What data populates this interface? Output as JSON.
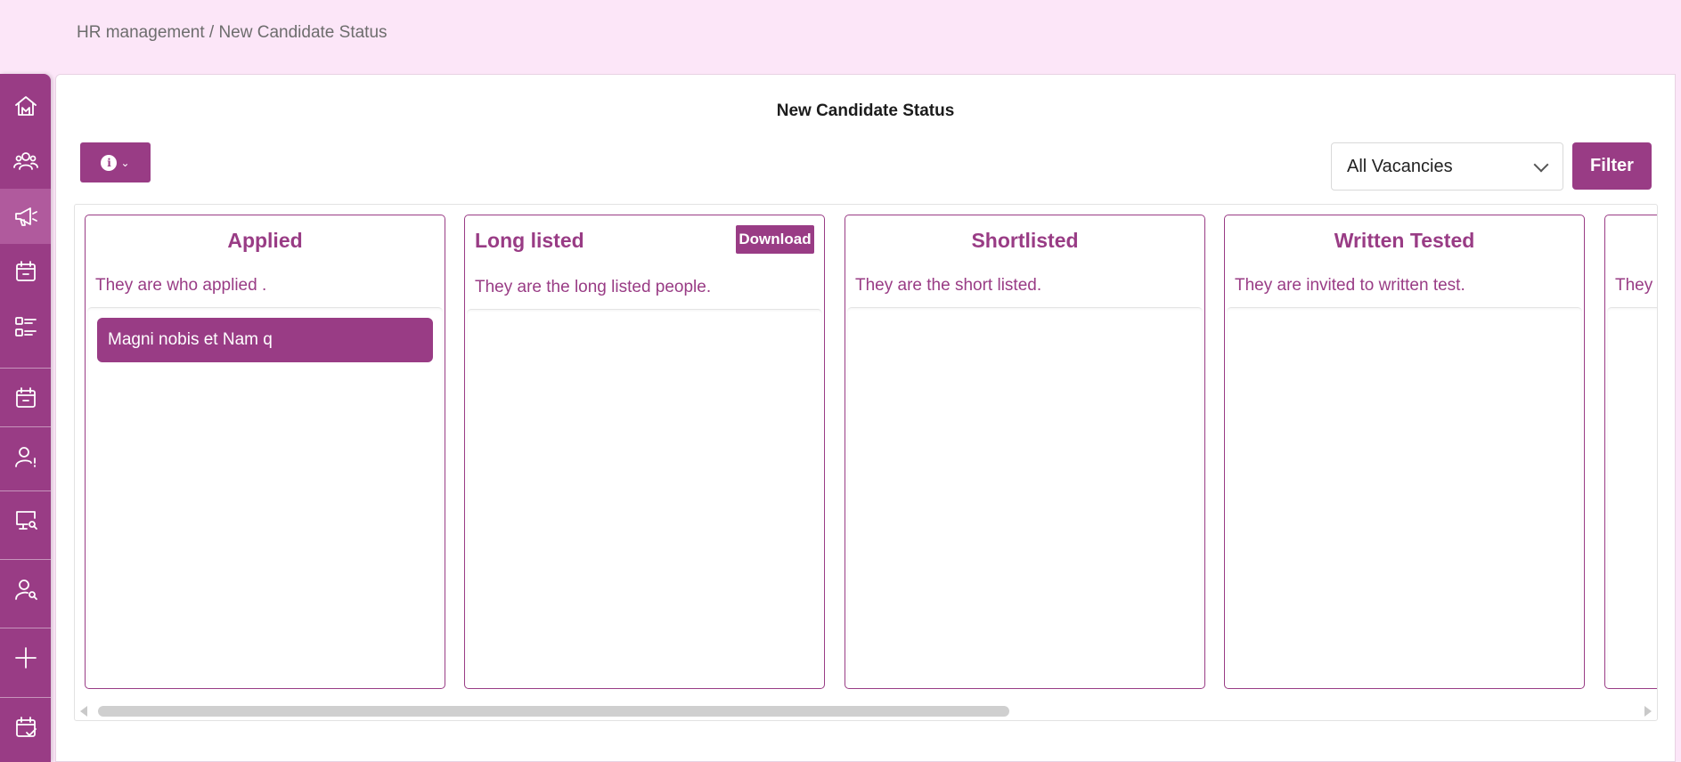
{
  "breadcrumb": "HR management / New Candidate Status",
  "page": {
    "title": "New Candidate Status"
  },
  "toolbar": {
    "info_icon": "i",
    "info_chevron": "⌄",
    "vacancy_selected": "All Vacancies",
    "filter_label": "Filter"
  },
  "sidebar": {
    "items": [
      {
        "icon": "home-icon"
      },
      {
        "icon": "users-icon"
      },
      {
        "icon": "megaphone-icon",
        "active": true
      },
      {
        "icon": "calendar-icon"
      },
      {
        "icon": "list-icon"
      },
      {
        "icon": "calendar-icon"
      },
      {
        "icon": "user-alert-icon"
      },
      {
        "icon": "monitor-search-icon"
      },
      {
        "icon": "user-search-icon"
      },
      {
        "icon": "plus-icon"
      },
      {
        "icon": "calendar-check-icon"
      }
    ]
  },
  "columns": [
    {
      "title": "Applied",
      "description": "They are who applied .",
      "cards": [
        "Magni nobis et Nam q"
      ]
    },
    {
      "title": "Long listed",
      "description": "They are the long listed people.",
      "download_label": "Download",
      "cards": []
    },
    {
      "title": "Shortlisted",
      "description": "They are the short listed.",
      "cards": []
    },
    {
      "title": "Written Tested",
      "description": "They are invited to written test.",
      "cards": []
    },
    {
      "title": "",
      "description": "They",
      "cards": []
    }
  ],
  "colors": {
    "accent": "#993c85",
    "background": "#fce6f8"
  }
}
